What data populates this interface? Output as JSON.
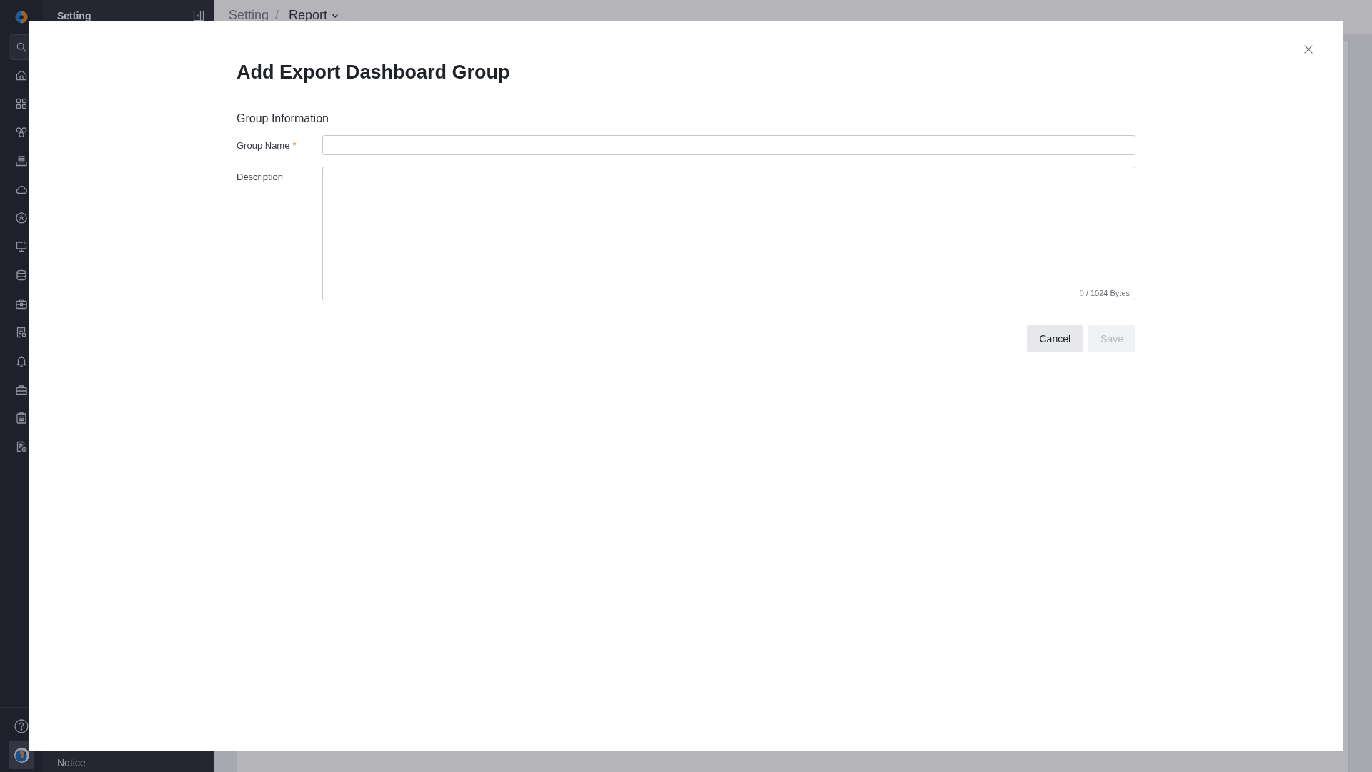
{
  "sidebar": {
    "title": "Setting",
    "footer_item": "Notice"
  },
  "breadcrumb": {
    "separator": "/",
    "items": [
      {
        "label": "Setting",
        "kind": "link"
      },
      {
        "label": "Report",
        "kind": "dropdown"
      }
    ]
  },
  "dialog": {
    "title": "Add Export Dashboard Group",
    "section_title": "Group Information",
    "fields": [
      {
        "kind": "input",
        "label": "Group Name",
        "required_mark": "*"
      },
      {
        "kind": "textarea",
        "label": "Description",
        "counter": {
          "count": "0",
          "limit": "/ 1024 Bytes"
        }
      }
    ],
    "buttons": [
      {
        "label": "Cancel",
        "disabled": false
      },
      {
        "label": "Save",
        "disabled": true
      }
    ]
  }
}
